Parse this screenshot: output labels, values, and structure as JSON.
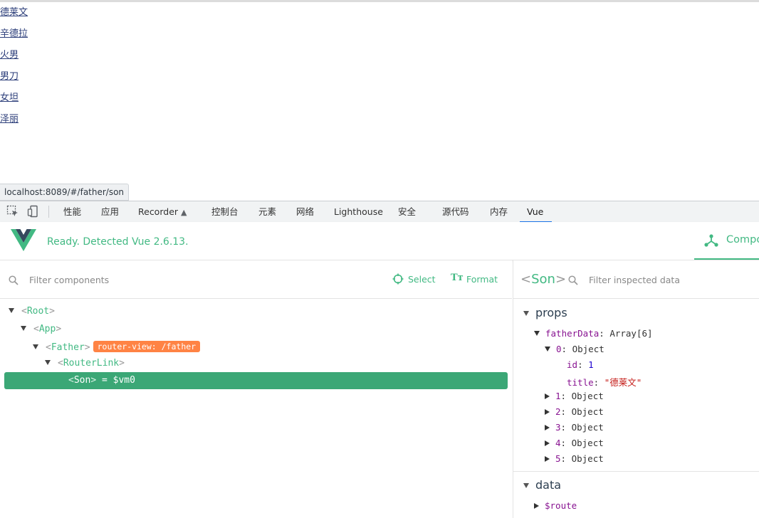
{
  "page": {
    "links": [
      "德莱文",
      "辛德拉",
      "火男",
      "男刀",
      "女坦",
      "泽丽"
    ],
    "status_url": "localhost:8089/#/father/son"
  },
  "devtools": {
    "tabs": [
      "性能",
      "应用",
      "Recorder",
      "控制台",
      "元素",
      "网络",
      "Lighthouse",
      "安全",
      "源代码",
      "内存",
      "Vue"
    ],
    "active_tab": "Vue"
  },
  "vue": {
    "status": "Ready. Detected Vue 2.6.13.",
    "main_tab": "Compo",
    "accent_color": "#42b983",
    "tree_toolbar": {
      "filter_placeholder": "Filter components",
      "select_label": "Select",
      "format_label": "Format"
    },
    "tree": {
      "root": "Root",
      "app": "App",
      "father": "Father",
      "father_badge": "router-view: /father",
      "router_link": "RouterLink",
      "son": "Son",
      "son_suffix": "= $vm0"
    },
    "inspector": {
      "component": "Son",
      "filter_placeholder": "Filter inspected data",
      "props_label": "props",
      "data_label": "data",
      "father_data_key": "fatherData",
      "father_data_value": "Array[6]",
      "items": [
        {
          "key": "0",
          "value": "Object",
          "expanded": true
        },
        {
          "key": "1",
          "value": "Object"
        },
        {
          "key": "2",
          "value": "Object"
        },
        {
          "key": "3",
          "value": "Object"
        },
        {
          "key": "4",
          "value": "Object"
        },
        {
          "key": "5",
          "value": "Object"
        }
      ],
      "item0_id_key": "id",
      "item0_id_value": "1",
      "item0_title_key": "title",
      "item0_title_value": "\"德莱文\"",
      "route_key": "$route"
    }
  }
}
